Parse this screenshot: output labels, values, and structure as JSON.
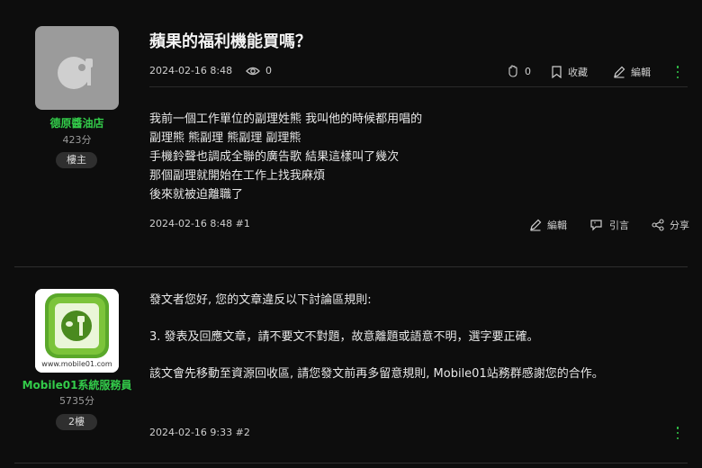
{
  "post1": {
    "author": "德原醬油店",
    "score": "423分",
    "badge": "樓主",
    "title": "蘋果的福利機能買嗎？",
    "date": "2024-02-16 8:48",
    "views": "0",
    "likes": "0",
    "bookmark_label": "收藏",
    "edit_label": "編輯",
    "body": [
      "我前一個工作單位的副理姓熊 我叫他的時候都用唱的",
      "副理熊 熊副理 熊副理 副理熊",
      "手機鈴聲也調成全聯的廣告歌 結果這樣叫了幾次",
      "那個副理就開始在工作上找我麻煩",
      "後來就被迫離職了"
    ],
    "footer_meta": "2024-02-16 8:48 #1",
    "footer_edit": "編輯",
    "footer_quote": "引言",
    "footer_share": "分享"
  },
  "post2": {
    "author": "Mobile01系統服務員",
    "score": "5735分",
    "badge": "2樓",
    "logo_url_text": "www.mobile01.com",
    "body": [
      "發文者您好, 您的文章違反以下討論區規則:",
      "3. 發表及回應文章，請不要文不對題，故意離題或語意不明，選字要正確。",
      "該文會先移動至資源回收區, 請您發文前再多留意規則, Mobile01站務群感謝您的合作。"
    ],
    "footer_meta": "2024-02-16 9:33 #2"
  },
  "colors": {
    "background": "#0d0d0d",
    "accent_green": "#33cc4a",
    "text": "#e6e6e6"
  }
}
